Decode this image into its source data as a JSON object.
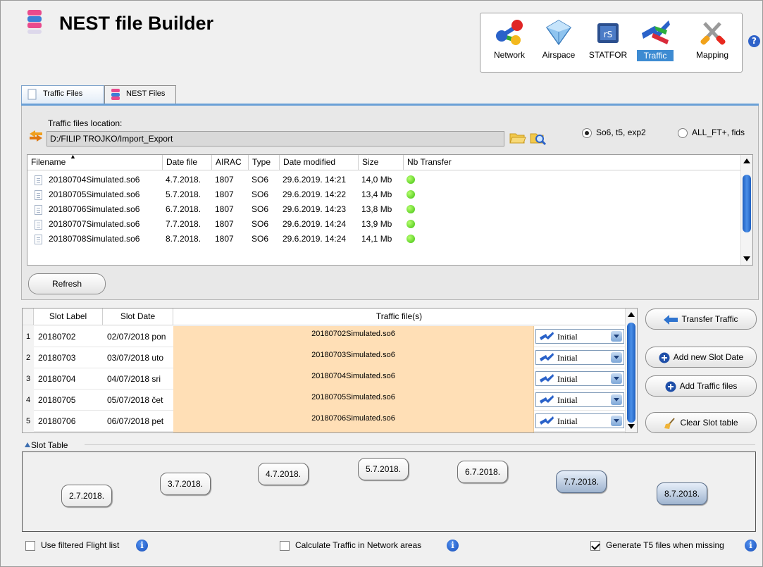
{
  "app": {
    "title": "NEST file Builder",
    "help": "?"
  },
  "modules": [
    {
      "label": "Network",
      "icon": "network-icon"
    },
    {
      "label": "Airspace",
      "icon": "airspace-icon"
    },
    {
      "label": "STATFOR",
      "icon": "statfor-icon"
    },
    {
      "label": "Traffic",
      "icon": "traffic-icon",
      "active": true
    },
    {
      "label": "Mapping",
      "icon": "mapping-icon"
    }
  ],
  "tabs": [
    {
      "label": "Traffic Files",
      "active": true
    },
    {
      "label": "NEST Files",
      "active": false
    }
  ],
  "location": {
    "label": "Traffic files location:",
    "path": "D:/FILIP TROJKO/Import_Export"
  },
  "format_options": [
    {
      "label": "So6, t5, exp2",
      "selected": true
    },
    {
      "label": "ALL_FT+, fids",
      "selected": false
    }
  ],
  "file_table": {
    "columns": [
      "Filename",
      "Date file",
      "AIRAC",
      "Type",
      "Date modified",
      "Size",
      "Nb Transfer"
    ],
    "rows": [
      [
        "20180704Simulated.so6",
        "4.7.2018.",
        "1807",
        "SO6",
        "29.6.2019. 14:21",
        "14,0 Mb",
        "green"
      ],
      [
        "20180705Simulated.so6",
        "5.7.2018.",
        "1807",
        "SO6",
        "29.6.2019. 14:22",
        "13,4 Mb",
        "green"
      ],
      [
        "20180706Simulated.so6",
        "6.7.2018.",
        "1807",
        "SO6",
        "29.6.2019. 14:23",
        "13,8 Mb",
        "green"
      ],
      [
        "20180707Simulated.so6",
        "7.7.2018.",
        "1807",
        "SO6",
        "29.6.2019. 14:24",
        "13,9 Mb",
        "green"
      ],
      [
        "20180708Simulated.so6",
        "8.7.2018.",
        "1807",
        "SO6",
        "29.6.2019. 14:24",
        "14,1 Mb",
        "green"
      ]
    ]
  },
  "refresh_label": "Refresh",
  "slot_table": {
    "columns": [
      "Slot Label",
      "Slot Date",
      "Traffic file(s)"
    ],
    "rows": [
      {
        "num": "1",
        "label": "20180702",
        "date": "02/07/2018 pon",
        "file": "20180702Simulated.so6",
        "mode": "Initial"
      },
      {
        "num": "2",
        "label": "20180703",
        "date": "03/07/2018 uto",
        "file": "20180703Simulated.so6",
        "mode": "Initial"
      },
      {
        "num": "3",
        "label": "20180704",
        "date": "04/07/2018 sri",
        "file": "20180704Simulated.so6",
        "mode": "Initial"
      },
      {
        "num": "4",
        "label": "20180705",
        "date": "05/07/2018 čet",
        "file": "20180705Simulated.so6",
        "mode": "Initial"
      },
      {
        "num": "5",
        "label": "20180706",
        "date": "06/07/2018 pet",
        "file": "20180706Simulated.so6",
        "mode": "Initial"
      }
    ]
  },
  "actions": {
    "transfer": "Transfer Traffic",
    "add_slot": "Add new Slot Date",
    "add_files": "Add Traffic files",
    "clear": "Clear Slot table"
  },
  "slot_section": {
    "label": "Slot Table",
    "dates": [
      {
        "text": "2.7.2018.",
        "selected": false
      },
      {
        "text": "3.7.2018.",
        "selected": false
      },
      {
        "text": "4.7.2018.",
        "selected": false
      },
      {
        "text": "5.7.2018.",
        "selected": false
      },
      {
        "text": "6.7.2018.",
        "selected": false
      },
      {
        "text": "7.7.2018.",
        "selected": true
      },
      {
        "text": "8.7.2018.",
        "selected": true
      }
    ]
  },
  "options": [
    {
      "label": "Use filtered Flight list",
      "checked": false
    },
    {
      "label": "Calculate Traffic in Network areas",
      "checked": false
    },
    {
      "label": "Generate T5 files when missing",
      "checked": true
    }
  ],
  "colors": {
    "accent": "#3d8bd2",
    "traffic_cell": "#ffdfb6",
    "status_ok": "#3fc10f"
  }
}
